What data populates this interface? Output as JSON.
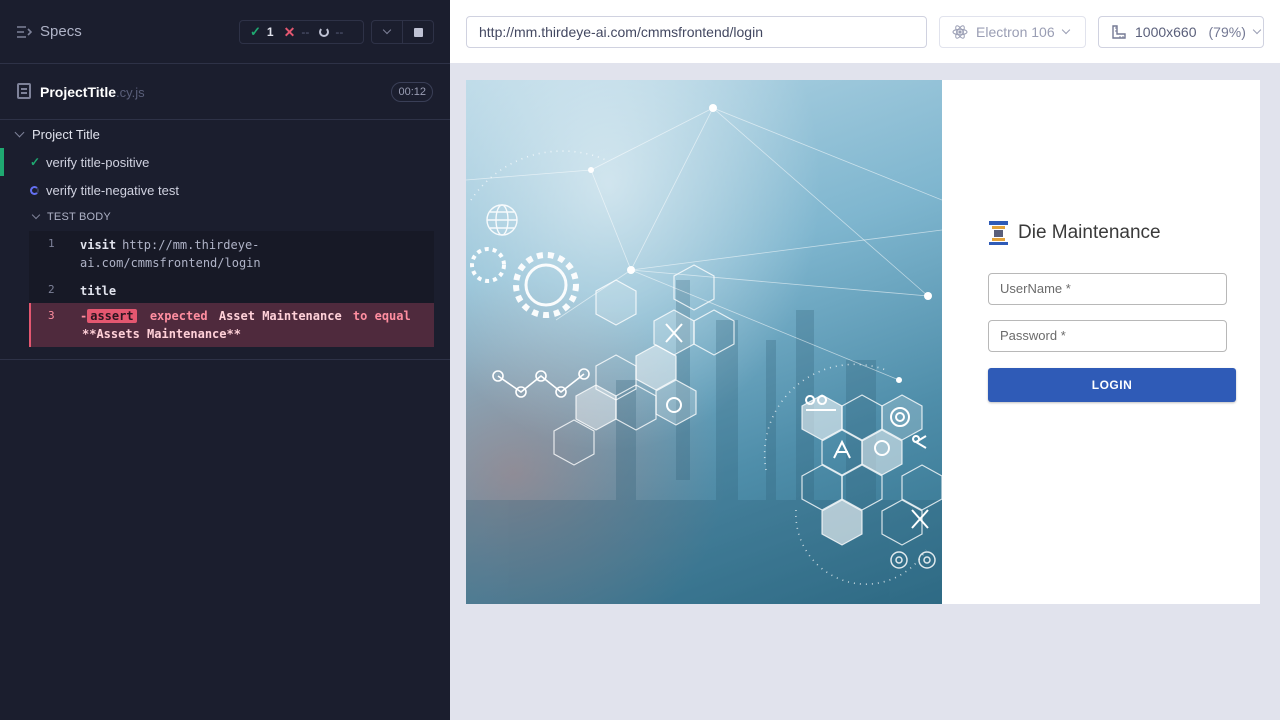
{
  "runner": {
    "specs_label": "Specs",
    "stats": {
      "passed": "1",
      "failed": "--",
      "pending": "--"
    },
    "spec": {
      "name": "ProjectTitle",
      "ext": ".cy.js",
      "duration": "00:12"
    },
    "suite_title": "Project Title",
    "tests": [
      {
        "title": "verify title-positive",
        "state": "passed"
      },
      {
        "title": "verify title-negative test",
        "state": "running"
      }
    ],
    "test_body_label": "TEST BODY",
    "commands": [
      {
        "index": "1",
        "name": "visit",
        "message": "http://mm.thirdeye-ai.com/cmmsfrontend/login"
      },
      {
        "index": "2",
        "name": "title",
        "message": ""
      },
      {
        "index": "3",
        "name": "assert",
        "prefix": "-",
        "message_part1": "expected",
        "message_value": "Asset Maintenance",
        "message_part2": "to equal",
        "message_expected": "**Assets Maintenance**"
      }
    ]
  },
  "aut": {
    "url": "http://mm.thirdeye-ai.com/cmmsfrontend/login",
    "browser": "Electron 106",
    "viewport": "1000x660",
    "zoom": "(79%)"
  },
  "login_page": {
    "brand_title": "Die Maintenance",
    "username_placeholder": "UserName *",
    "password_placeholder": "Password *",
    "login_button": "LOGIN"
  },
  "colors": {
    "runner_bg": "#1b1e2e",
    "pass_green": "#1fa971",
    "fail_red": "#e45770",
    "primary_button": "#2f5bb7"
  }
}
